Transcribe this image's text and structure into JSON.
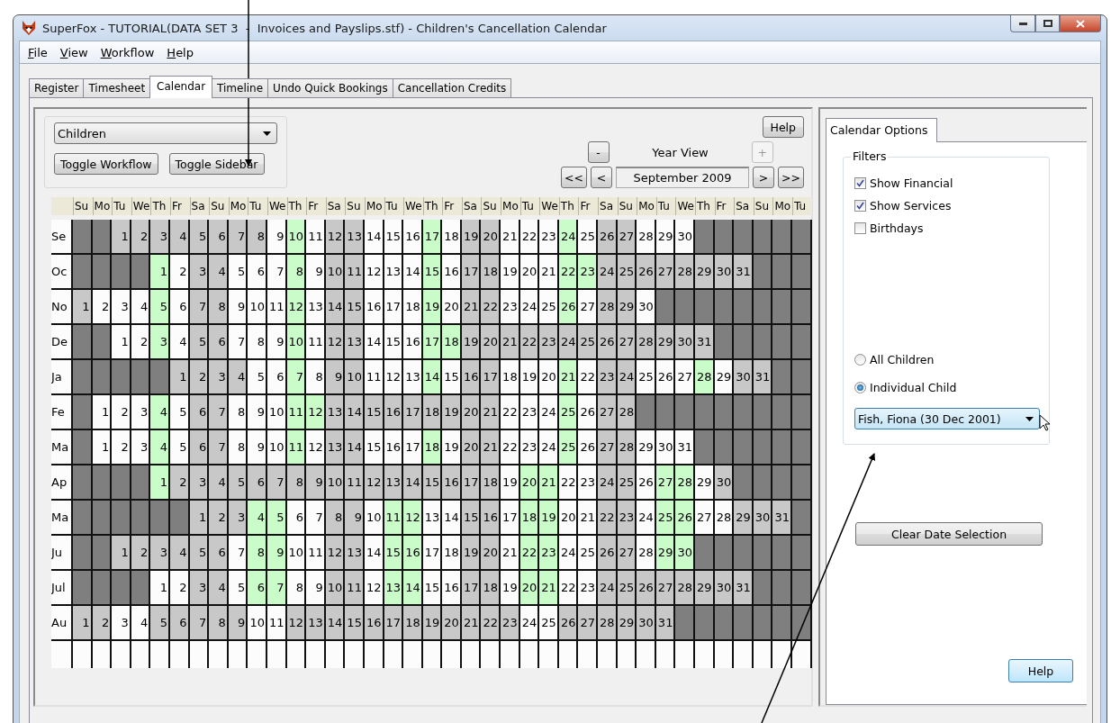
{
  "window": {
    "title": "SuperFox - TUTORIAL(DATA SET 3  -  Invoices and Payslips.stf) - Children's Cancellation Calendar"
  },
  "menu": [
    "File",
    "View",
    "Workflow",
    "Help"
  ],
  "tabs": [
    {
      "label": "Register",
      "selected": false
    },
    {
      "label": "Timesheet",
      "selected": false
    },
    {
      "label": "Calendar",
      "selected": true
    },
    {
      "label": "Timeline",
      "selected": false
    },
    {
      "label": "Undo Quick Bookings",
      "selected": false
    },
    {
      "label": "Cancellation Credits",
      "selected": false
    }
  ],
  "calendar": {
    "group_select": "Children",
    "buttons": [
      "Toggle Workflow",
      "Toggle Sidebar"
    ],
    "help": "Help",
    "zoom_out": {
      "label": "-",
      "disabled": false
    },
    "view": "Year View",
    "zoom_in": {
      "label": "+",
      "disabled": true
    },
    "nav_back": [
      "<<",
      "<"
    ],
    "period": "September 2009",
    "nav_forward": [
      ">",
      ">>"
    ],
    "weekdays": [
      "Su",
      "Mo",
      "Tu",
      "We",
      "Th",
      "Fr",
      "Sa",
      "Su",
      "Mo",
      "Tu",
      "We",
      "Th",
      "Fr",
      "Sa",
      "Su",
      "Mo",
      "Tu",
      "We",
      "Th",
      "Fr",
      "Sa",
      "Su",
      "Mo",
      "Tu",
      "We",
      "Th",
      "Fr",
      "Sa",
      "Su",
      "Mo",
      "Tu",
      "We",
      "Th",
      "Fr",
      "Sa",
      "Su",
      "Mo",
      "Tu"
    ],
    "months": [
      {
        "label": "Se",
        "cells": [
          {
            "kind": "dark"
          },
          {
            "kind": "dark"
          },
          {
            "day": "1",
            "kind": "grey"
          },
          {
            "day": "2",
            "kind": "grey"
          },
          {
            "day": "3",
            "kind": "grey"
          },
          {
            "day": "4",
            "kind": "grey"
          },
          {
            "day": "5",
            "kind": "grey"
          },
          {
            "day": "6",
            "kind": "grey"
          },
          {
            "day": "7",
            "kind": "grey"
          },
          {
            "day": "8",
            "kind": "grey"
          },
          {
            "day": "9",
            "kind": "white"
          },
          {
            "day": "10",
            "kind": "green"
          },
          {
            "day": "11",
            "kind": "white"
          },
          {
            "day": "12",
            "kind": "grey"
          },
          {
            "day": "13",
            "kind": "grey"
          },
          {
            "day": "14",
            "kind": "white"
          },
          {
            "day": "15",
            "kind": "white"
          },
          {
            "day": "16",
            "kind": "white"
          },
          {
            "day": "17",
            "kind": "green"
          },
          {
            "day": "18",
            "kind": "white"
          },
          {
            "day": "19",
            "kind": "grey"
          },
          {
            "day": "20",
            "kind": "grey"
          },
          {
            "day": "21",
            "kind": "white"
          },
          {
            "day": "22",
            "kind": "white"
          },
          {
            "day": "23",
            "kind": "white"
          },
          {
            "day": "24",
            "kind": "green"
          },
          {
            "day": "25",
            "kind": "white"
          },
          {
            "day": "26",
            "kind": "grey"
          },
          {
            "day": "27",
            "kind": "grey"
          },
          {
            "day": "28",
            "kind": "white"
          },
          {
            "day": "29",
            "kind": "white"
          },
          {
            "day": "30",
            "kind": "white"
          }
        ]
      },
      {
        "label": "Oc",
        "cells": [
          {
            "kind": "dark"
          },
          {
            "kind": "dark"
          },
          {
            "kind": "dark"
          },
          {
            "kind": "dark"
          },
          {
            "day": "1",
            "kind": "green"
          },
          {
            "day": "2",
            "kind": "white"
          },
          {
            "day": "3",
            "kind": "grey"
          },
          {
            "day": "4",
            "kind": "grey"
          },
          {
            "day": "5",
            "kind": "white"
          },
          {
            "day": "6",
            "kind": "white"
          },
          {
            "day": "7",
            "kind": "white"
          },
          {
            "day": "8",
            "kind": "green"
          },
          {
            "day": "9",
            "kind": "white"
          },
          {
            "day": "10",
            "kind": "grey"
          },
          {
            "day": "11",
            "kind": "grey"
          },
          {
            "day": "12",
            "kind": "white"
          },
          {
            "day": "13",
            "kind": "white"
          },
          {
            "day": "14",
            "kind": "white"
          },
          {
            "day": "15",
            "kind": "green"
          },
          {
            "day": "16",
            "kind": "white"
          },
          {
            "day": "17",
            "kind": "grey"
          },
          {
            "day": "18",
            "kind": "grey"
          },
          {
            "day": "19",
            "kind": "white"
          },
          {
            "day": "20",
            "kind": "white"
          },
          {
            "day": "21",
            "kind": "white"
          },
          {
            "day": "22",
            "kind": "green"
          },
          {
            "day": "23",
            "kind": "green"
          },
          {
            "day": "24",
            "kind": "grey"
          },
          {
            "day": "25",
            "kind": "grey"
          },
          {
            "day": "26",
            "kind": "grey"
          },
          {
            "day": "27",
            "kind": "grey"
          },
          {
            "day": "28",
            "kind": "grey"
          },
          {
            "day": "29",
            "kind": "grey"
          },
          {
            "day": "30",
            "kind": "grey"
          },
          {
            "day": "31",
            "kind": "grey"
          }
        ]
      },
      {
        "label": "No",
        "cells": [
          {
            "day": "1",
            "kind": "grey"
          },
          {
            "day": "2",
            "kind": "white"
          },
          {
            "day": "3",
            "kind": "white"
          },
          {
            "day": "4",
            "kind": "white"
          },
          {
            "day": "5",
            "kind": "green"
          },
          {
            "day": "6",
            "kind": "white"
          },
          {
            "day": "7",
            "kind": "grey"
          },
          {
            "day": "8",
            "kind": "grey"
          },
          {
            "day": "9",
            "kind": "white"
          },
          {
            "day": "10",
            "kind": "white"
          },
          {
            "day": "11",
            "kind": "white"
          },
          {
            "day": "12",
            "kind": "green"
          },
          {
            "day": "13",
            "kind": "white"
          },
          {
            "day": "14",
            "kind": "grey"
          },
          {
            "day": "15",
            "kind": "grey"
          },
          {
            "day": "16",
            "kind": "white"
          },
          {
            "day": "17",
            "kind": "white"
          },
          {
            "day": "18",
            "kind": "white"
          },
          {
            "day": "19",
            "kind": "green"
          },
          {
            "day": "20",
            "kind": "white"
          },
          {
            "day": "21",
            "kind": "grey"
          },
          {
            "day": "22",
            "kind": "grey"
          },
          {
            "day": "23",
            "kind": "white"
          },
          {
            "day": "24",
            "kind": "white"
          },
          {
            "day": "25",
            "kind": "white"
          },
          {
            "day": "26",
            "kind": "green"
          },
          {
            "day": "27",
            "kind": "white"
          },
          {
            "day": "28",
            "kind": "grey"
          },
          {
            "day": "29",
            "kind": "grey"
          },
          {
            "day": "30",
            "kind": "white"
          }
        ]
      },
      {
        "label": "De",
        "cells": [
          {
            "kind": "dark"
          },
          {
            "kind": "dark"
          },
          {
            "day": "1",
            "kind": "white"
          },
          {
            "day": "2",
            "kind": "white"
          },
          {
            "day": "3",
            "kind": "green"
          },
          {
            "day": "4",
            "kind": "white"
          },
          {
            "day": "5",
            "kind": "grey"
          },
          {
            "day": "6",
            "kind": "grey"
          },
          {
            "day": "7",
            "kind": "white"
          },
          {
            "day": "8",
            "kind": "white"
          },
          {
            "day": "9",
            "kind": "white"
          },
          {
            "day": "10",
            "kind": "green"
          },
          {
            "day": "11",
            "kind": "white"
          },
          {
            "day": "12",
            "kind": "grey"
          },
          {
            "day": "13",
            "kind": "grey"
          },
          {
            "day": "14",
            "kind": "white"
          },
          {
            "day": "15",
            "kind": "white"
          },
          {
            "day": "16",
            "kind": "white"
          },
          {
            "day": "17",
            "kind": "green"
          },
          {
            "day": "18",
            "kind": "green"
          },
          {
            "day": "19",
            "kind": "grey"
          },
          {
            "day": "20",
            "kind": "grey"
          },
          {
            "day": "21",
            "kind": "grey"
          },
          {
            "day": "22",
            "kind": "grey"
          },
          {
            "day": "23",
            "kind": "grey"
          },
          {
            "day": "24",
            "kind": "grey"
          },
          {
            "day": "25",
            "kind": "grey"
          },
          {
            "day": "26",
            "kind": "grey"
          },
          {
            "day": "27",
            "kind": "grey"
          },
          {
            "day": "28",
            "kind": "grey"
          },
          {
            "day": "29",
            "kind": "grey"
          },
          {
            "day": "30",
            "kind": "grey"
          },
          {
            "day": "31",
            "kind": "grey"
          }
        ]
      },
      {
        "label": "Ja",
        "cells": [
          {
            "kind": "dark"
          },
          {
            "kind": "dark"
          },
          {
            "kind": "dark"
          },
          {
            "kind": "dark"
          },
          {
            "kind": "dark"
          },
          {
            "day": "1",
            "kind": "grey"
          },
          {
            "day": "2",
            "kind": "grey"
          },
          {
            "day": "3",
            "kind": "grey"
          },
          {
            "day": "4",
            "kind": "grey"
          },
          {
            "day": "5",
            "kind": "white"
          },
          {
            "day": "6",
            "kind": "white"
          },
          {
            "day": "7",
            "kind": "green"
          },
          {
            "day": "8",
            "kind": "white"
          },
          {
            "day": "9",
            "kind": "grey"
          },
          {
            "day": "10",
            "kind": "grey"
          },
          {
            "day": "11",
            "kind": "white"
          },
          {
            "day": "12",
            "kind": "white"
          },
          {
            "day": "13",
            "kind": "white"
          },
          {
            "day": "14",
            "kind": "green"
          },
          {
            "day": "15",
            "kind": "white"
          },
          {
            "day": "16",
            "kind": "grey"
          },
          {
            "day": "17",
            "kind": "grey"
          },
          {
            "day": "18",
            "kind": "white"
          },
          {
            "day": "19",
            "kind": "white"
          },
          {
            "day": "20",
            "kind": "white"
          },
          {
            "day": "21",
            "kind": "green"
          },
          {
            "day": "22",
            "kind": "white"
          },
          {
            "day": "23",
            "kind": "grey"
          },
          {
            "day": "24",
            "kind": "grey"
          },
          {
            "day": "25",
            "kind": "white"
          },
          {
            "day": "26",
            "kind": "white"
          },
          {
            "day": "27",
            "kind": "white"
          },
          {
            "day": "28",
            "kind": "green"
          },
          {
            "day": "29",
            "kind": "white"
          },
          {
            "day": "30",
            "kind": "grey"
          },
          {
            "day": "31",
            "kind": "grey"
          }
        ]
      },
      {
        "label": "Fe",
        "cells": [
          {
            "kind": "dark"
          },
          {
            "day": "1",
            "kind": "white"
          },
          {
            "day": "2",
            "kind": "white"
          },
          {
            "day": "3",
            "kind": "white"
          },
          {
            "day": "4",
            "kind": "green"
          },
          {
            "day": "5",
            "kind": "white"
          },
          {
            "day": "6",
            "kind": "grey"
          },
          {
            "day": "7",
            "kind": "grey"
          },
          {
            "day": "8",
            "kind": "white"
          },
          {
            "day": "9",
            "kind": "white"
          },
          {
            "day": "10",
            "kind": "white"
          },
          {
            "day": "11",
            "kind": "green"
          },
          {
            "day": "12",
            "kind": "green"
          },
          {
            "day": "13",
            "kind": "grey"
          },
          {
            "day": "14",
            "kind": "grey"
          },
          {
            "day": "15",
            "kind": "grey"
          },
          {
            "day": "16",
            "kind": "grey"
          },
          {
            "day": "17",
            "kind": "grey"
          },
          {
            "day": "18",
            "kind": "grey"
          },
          {
            "day": "19",
            "kind": "grey"
          },
          {
            "day": "20",
            "kind": "grey"
          },
          {
            "day": "21",
            "kind": "grey"
          },
          {
            "day": "22",
            "kind": "white"
          },
          {
            "day": "23",
            "kind": "white"
          },
          {
            "day": "24",
            "kind": "white"
          },
          {
            "day": "25",
            "kind": "green"
          },
          {
            "day": "26",
            "kind": "white"
          },
          {
            "day": "27",
            "kind": "grey"
          },
          {
            "day": "28",
            "kind": "grey"
          }
        ]
      },
      {
        "label": "Ma",
        "cells": [
          {
            "kind": "dark"
          },
          {
            "day": "1",
            "kind": "white"
          },
          {
            "day": "2",
            "kind": "white"
          },
          {
            "day": "3",
            "kind": "white"
          },
          {
            "day": "4",
            "kind": "green"
          },
          {
            "day": "5",
            "kind": "white"
          },
          {
            "day": "6",
            "kind": "grey"
          },
          {
            "day": "7",
            "kind": "grey"
          },
          {
            "day": "8",
            "kind": "white"
          },
          {
            "day": "9",
            "kind": "white"
          },
          {
            "day": "10",
            "kind": "white"
          },
          {
            "day": "11",
            "kind": "green"
          },
          {
            "day": "12",
            "kind": "white"
          },
          {
            "day": "13",
            "kind": "grey"
          },
          {
            "day": "14",
            "kind": "grey"
          },
          {
            "day": "15",
            "kind": "white"
          },
          {
            "day": "16",
            "kind": "white"
          },
          {
            "day": "17",
            "kind": "white"
          },
          {
            "day": "18",
            "kind": "green"
          },
          {
            "day": "19",
            "kind": "white"
          },
          {
            "day": "20",
            "kind": "grey"
          },
          {
            "day": "21",
            "kind": "grey"
          },
          {
            "day": "22",
            "kind": "white"
          },
          {
            "day": "23",
            "kind": "white"
          },
          {
            "day": "24",
            "kind": "white"
          },
          {
            "day": "25",
            "kind": "green"
          },
          {
            "day": "26",
            "kind": "white"
          },
          {
            "day": "27",
            "kind": "grey"
          },
          {
            "day": "28",
            "kind": "grey"
          },
          {
            "day": "29",
            "kind": "white"
          },
          {
            "day": "30",
            "kind": "white"
          },
          {
            "day": "31",
            "kind": "white"
          }
        ]
      },
      {
        "label": "Ap",
        "cells": [
          {
            "kind": "dark"
          },
          {
            "kind": "dark"
          },
          {
            "kind": "dark"
          },
          {
            "kind": "dark"
          },
          {
            "day": "1",
            "kind": "green"
          },
          {
            "day": "2",
            "kind": "grey"
          },
          {
            "day": "3",
            "kind": "grey"
          },
          {
            "day": "4",
            "kind": "grey"
          },
          {
            "day": "5",
            "kind": "grey"
          },
          {
            "day": "6",
            "kind": "grey"
          },
          {
            "day": "7",
            "kind": "grey"
          },
          {
            "day": "8",
            "kind": "grey"
          },
          {
            "day": "9",
            "kind": "grey"
          },
          {
            "day": "10",
            "kind": "grey"
          },
          {
            "day": "11",
            "kind": "grey"
          },
          {
            "day": "12",
            "kind": "grey"
          },
          {
            "day": "13",
            "kind": "grey"
          },
          {
            "day": "14",
            "kind": "grey"
          },
          {
            "day": "15",
            "kind": "grey"
          },
          {
            "day": "16",
            "kind": "grey"
          },
          {
            "day": "17",
            "kind": "grey"
          },
          {
            "day": "18",
            "kind": "grey"
          },
          {
            "day": "19",
            "kind": "white"
          },
          {
            "day": "20",
            "kind": "green"
          },
          {
            "day": "21",
            "kind": "green"
          },
          {
            "day": "22",
            "kind": "white"
          },
          {
            "day": "23",
            "kind": "white"
          },
          {
            "day": "24",
            "kind": "grey"
          },
          {
            "day": "25",
            "kind": "grey"
          },
          {
            "day": "26",
            "kind": "white"
          },
          {
            "day": "27",
            "kind": "green"
          },
          {
            "day": "28",
            "kind": "green"
          },
          {
            "day": "29",
            "kind": "white"
          },
          {
            "day": "30",
            "kind": "grey"
          }
        ]
      },
      {
        "label": "Ma",
        "cells": [
          {
            "kind": "dark"
          },
          {
            "kind": "dark"
          },
          {
            "kind": "dark"
          },
          {
            "kind": "dark"
          },
          {
            "kind": "dark"
          },
          {
            "kind": "dark"
          },
          {
            "day": "1",
            "kind": "grey"
          },
          {
            "day": "2",
            "kind": "grey"
          },
          {
            "day": "3",
            "kind": "grey"
          },
          {
            "day": "4",
            "kind": "green"
          },
          {
            "day": "5",
            "kind": "green"
          },
          {
            "day": "6",
            "kind": "white"
          },
          {
            "day": "7",
            "kind": "white"
          },
          {
            "day": "8",
            "kind": "grey"
          },
          {
            "day": "9",
            "kind": "grey"
          },
          {
            "day": "10",
            "kind": "white"
          },
          {
            "day": "11",
            "kind": "green"
          },
          {
            "day": "12",
            "kind": "green"
          },
          {
            "day": "13",
            "kind": "white"
          },
          {
            "day": "14",
            "kind": "white"
          },
          {
            "day": "15",
            "kind": "grey"
          },
          {
            "day": "16",
            "kind": "grey"
          },
          {
            "day": "17",
            "kind": "white"
          },
          {
            "day": "18",
            "kind": "green"
          },
          {
            "day": "19",
            "kind": "green"
          },
          {
            "day": "20",
            "kind": "white"
          },
          {
            "day": "21",
            "kind": "white"
          },
          {
            "day": "22",
            "kind": "grey"
          },
          {
            "day": "23",
            "kind": "grey"
          },
          {
            "day": "24",
            "kind": "white"
          },
          {
            "day": "25",
            "kind": "green"
          },
          {
            "day": "26",
            "kind": "green"
          },
          {
            "day": "27",
            "kind": "white"
          },
          {
            "day": "28",
            "kind": "white"
          },
          {
            "day": "29",
            "kind": "grey"
          },
          {
            "day": "30",
            "kind": "grey"
          },
          {
            "day": "31",
            "kind": "grey"
          }
        ]
      },
      {
        "label": "Ju",
        "cells": [
          {
            "kind": "dark"
          },
          {
            "kind": "dark"
          },
          {
            "day": "1",
            "kind": "grey"
          },
          {
            "day": "2",
            "kind": "grey"
          },
          {
            "day": "3",
            "kind": "grey"
          },
          {
            "day": "4",
            "kind": "grey"
          },
          {
            "day": "5",
            "kind": "grey"
          },
          {
            "day": "6",
            "kind": "grey"
          },
          {
            "day": "7",
            "kind": "white"
          },
          {
            "day": "8",
            "kind": "green"
          },
          {
            "day": "9",
            "kind": "green"
          },
          {
            "day": "10",
            "kind": "white"
          },
          {
            "day": "11",
            "kind": "white"
          },
          {
            "day": "12",
            "kind": "grey"
          },
          {
            "day": "13",
            "kind": "grey"
          },
          {
            "day": "14",
            "kind": "white"
          },
          {
            "day": "15",
            "kind": "green"
          },
          {
            "day": "16",
            "kind": "green"
          },
          {
            "day": "17",
            "kind": "white"
          },
          {
            "day": "18",
            "kind": "white"
          },
          {
            "day": "19",
            "kind": "grey"
          },
          {
            "day": "20",
            "kind": "grey"
          },
          {
            "day": "21",
            "kind": "white"
          },
          {
            "day": "22",
            "kind": "green"
          },
          {
            "day": "23",
            "kind": "green"
          },
          {
            "day": "24",
            "kind": "white"
          },
          {
            "day": "25",
            "kind": "white"
          },
          {
            "day": "26",
            "kind": "grey"
          },
          {
            "day": "27",
            "kind": "grey"
          },
          {
            "day": "28",
            "kind": "white"
          },
          {
            "day": "29",
            "kind": "green"
          },
          {
            "day": "30",
            "kind": "green"
          }
        ]
      },
      {
        "label": "Jul",
        "cells": [
          {
            "kind": "dark"
          },
          {
            "kind": "dark"
          },
          {
            "kind": "dark"
          },
          {
            "kind": "dark"
          },
          {
            "day": "1",
            "kind": "white"
          },
          {
            "day": "2",
            "kind": "white"
          },
          {
            "day": "3",
            "kind": "grey"
          },
          {
            "day": "4",
            "kind": "grey"
          },
          {
            "day": "5",
            "kind": "white"
          },
          {
            "day": "6",
            "kind": "green"
          },
          {
            "day": "7",
            "kind": "green"
          },
          {
            "day": "8",
            "kind": "white"
          },
          {
            "day": "9",
            "kind": "white"
          },
          {
            "day": "10",
            "kind": "grey"
          },
          {
            "day": "11",
            "kind": "grey"
          },
          {
            "day": "12",
            "kind": "white"
          },
          {
            "day": "13",
            "kind": "green"
          },
          {
            "day": "14",
            "kind": "green"
          },
          {
            "day": "15",
            "kind": "white"
          },
          {
            "day": "16",
            "kind": "white"
          },
          {
            "day": "17",
            "kind": "grey"
          },
          {
            "day": "18",
            "kind": "grey"
          },
          {
            "day": "19",
            "kind": "white"
          },
          {
            "day": "20",
            "kind": "green"
          },
          {
            "day": "21",
            "kind": "green"
          },
          {
            "day": "22",
            "kind": "white"
          },
          {
            "day": "23",
            "kind": "white"
          },
          {
            "day": "24",
            "kind": "grey"
          },
          {
            "day": "25",
            "kind": "grey"
          },
          {
            "day": "26",
            "kind": "grey"
          },
          {
            "day": "27",
            "kind": "grey"
          },
          {
            "day": "28",
            "kind": "grey"
          },
          {
            "day": "29",
            "kind": "grey"
          },
          {
            "day": "30",
            "kind": "grey"
          },
          {
            "day": "31",
            "kind": "grey"
          }
        ]
      },
      {
        "label": "Au",
        "cells": [
          {
            "day": "1",
            "kind": "grey"
          },
          {
            "day": "2",
            "kind": "grey"
          },
          {
            "day": "3",
            "kind": "white"
          },
          {
            "day": "4",
            "kind": "white"
          },
          {
            "day": "5",
            "kind": "grey"
          },
          {
            "day": "6",
            "kind": "grey"
          },
          {
            "day": "7",
            "kind": "grey"
          },
          {
            "day": "8",
            "kind": "grey"
          },
          {
            "day": "9",
            "kind": "grey"
          },
          {
            "day": "10",
            "kind": "white"
          },
          {
            "day": "11",
            "kind": "white"
          },
          {
            "day": "12",
            "kind": "grey"
          },
          {
            "day": "13",
            "kind": "grey"
          },
          {
            "day": "14",
            "kind": "grey"
          },
          {
            "day": "15",
            "kind": "grey"
          },
          {
            "day": "16",
            "kind": "grey"
          },
          {
            "day": "17",
            "kind": "grey"
          },
          {
            "day": "18",
            "kind": "grey"
          },
          {
            "day": "19",
            "kind": "grey"
          },
          {
            "day": "20",
            "kind": "grey"
          },
          {
            "day": "21",
            "kind": "grey"
          },
          {
            "day": "22",
            "kind": "grey"
          },
          {
            "day": "23",
            "kind": "grey"
          },
          {
            "day": "24",
            "kind": "white"
          },
          {
            "day": "25",
            "kind": "white"
          },
          {
            "day": "26",
            "kind": "grey"
          },
          {
            "day": "27",
            "kind": "grey"
          },
          {
            "day": "28",
            "kind": "grey"
          },
          {
            "day": "29",
            "kind": "grey"
          },
          {
            "day": "30",
            "kind": "grey"
          },
          {
            "day": "31",
            "kind": "grey"
          }
        ]
      }
    ]
  },
  "sidebar": {
    "tab": "Calendar Options",
    "filters_title": "Filters",
    "filters": [
      {
        "label": "Show Financial",
        "checked": true
      },
      {
        "label": "Show Services",
        "checked": true
      },
      {
        "label": "Birthdays",
        "checked": false
      }
    ],
    "scope": [
      {
        "label": "All Children",
        "selected": false
      },
      {
        "label": "Individual Child",
        "selected": true
      }
    ],
    "child": "Fish, Fiona (30 Dec 2001)",
    "clear": "Clear Date Selection",
    "help": "Help"
  }
}
